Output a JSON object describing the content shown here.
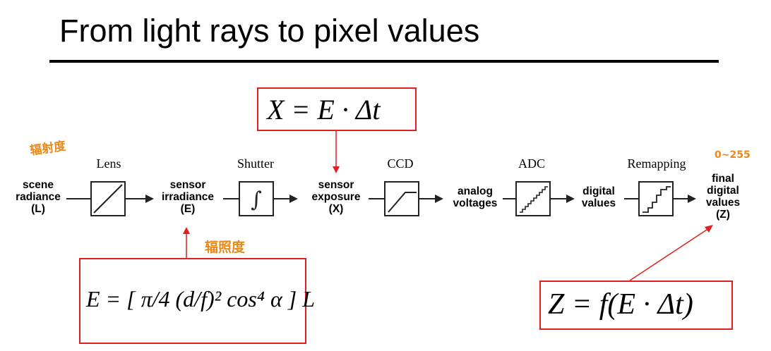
{
  "title": "From light rays to pixel values",
  "pipeline": {
    "stages": [
      {
        "name": "scene-radiance",
        "lines": [
          "scene",
          "radiance",
          "(L)"
        ]
      },
      {
        "name": "sensor-irradiance",
        "lines": [
          "sensor",
          "irradiance",
          "(E)"
        ]
      },
      {
        "name": "sensor-exposure",
        "lines": [
          "sensor",
          "exposure",
          "(X)"
        ]
      },
      {
        "name": "analog-voltages",
        "lines": [
          "analog",
          "voltages"
        ]
      },
      {
        "name": "digital-values",
        "lines": [
          "digital",
          "values"
        ]
      },
      {
        "name": "final-digital-values",
        "lines": [
          "final",
          "digital",
          "values",
          "(Z)"
        ]
      }
    ],
    "blocks": [
      "Lens",
      "Shutter",
      "CCD",
      "ADC",
      "Remapping"
    ]
  },
  "equations": {
    "exposure": "X = E · Δt",
    "irradiance": "E = [ π/4 (d/f)² cos⁴ α ] L",
    "final": "Z = f(E · Δt)"
  },
  "annotations": {
    "radiance_note": "辐射度",
    "irradiance_note": "辐照度",
    "range_note": "0~255"
  },
  "colors": {
    "annotation_line": "#e02020",
    "note": "#e8891a",
    "block": "#222222"
  }
}
